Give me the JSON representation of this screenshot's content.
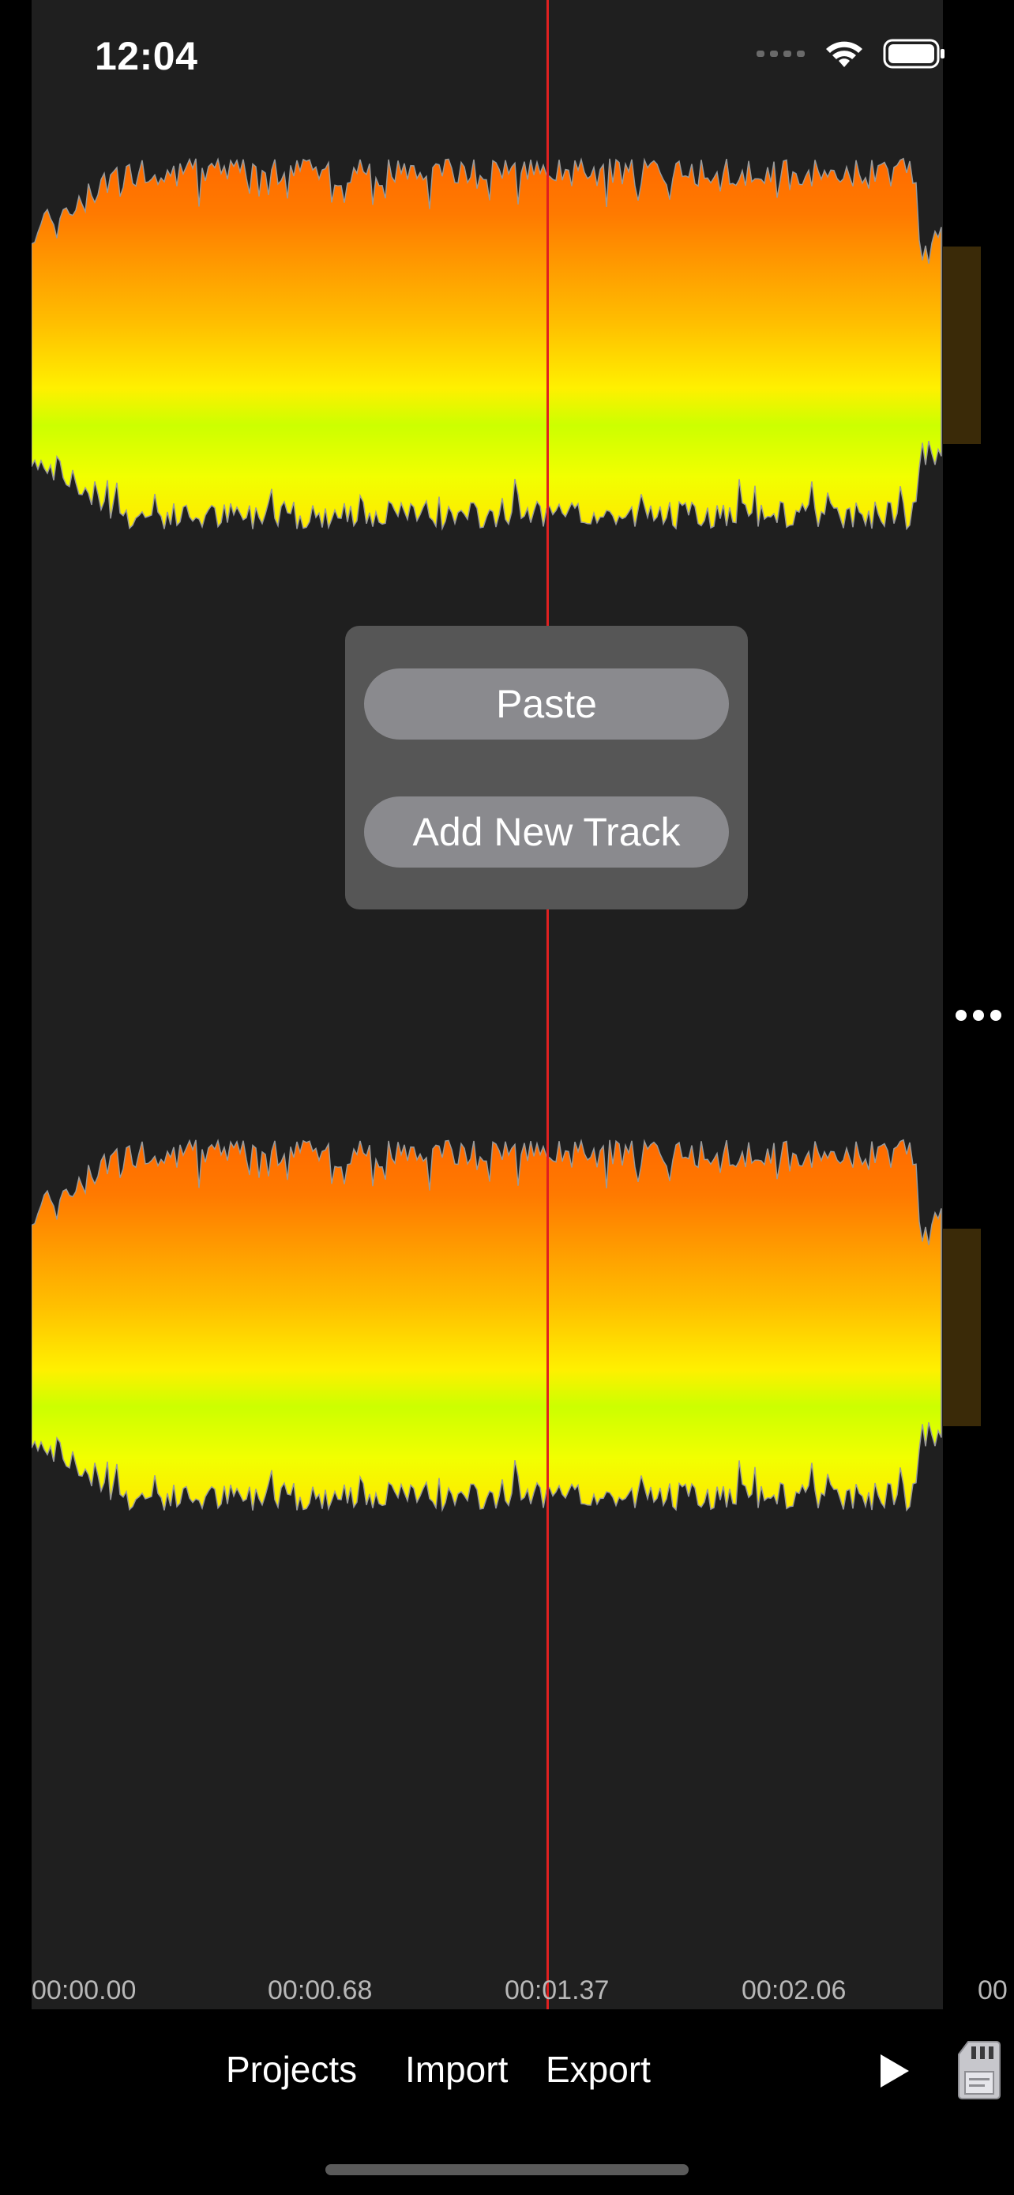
{
  "status_bar": {
    "time": "12:04",
    "signal_icon": "cellular-dots-icon",
    "wifi_icon": "wifi-icon",
    "battery_icon": "battery-icon"
  },
  "colors": {
    "editor_background": "#1f1f1f",
    "playhead": "#e02020",
    "wave_top": "#ff6a00",
    "wave_mid": "#ffd000",
    "wave_band": "#ccff00",
    "menu_background": "#565656",
    "menu_button": "#8a8a8e"
  },
  "context_menu": {
    "paste_label": "Paste",
    "add_track_label": "Add New Track"
  },
  "track_options_icon": "more-horizontal-icon",
  "timeline": {
    "ticks": [
      "00:00.00",
      "00:00.68",
      "00:01.37",
      "00:02.06",
      "00"
    ]
  },
  "bottom_bar": {
    "projects_label": "Projects",
    "import_label": "Import",
    "export_label": "Export",
    "play_icon": "play-icon",
    "sd_card_icon": "sd-card-icon"
  }
}
